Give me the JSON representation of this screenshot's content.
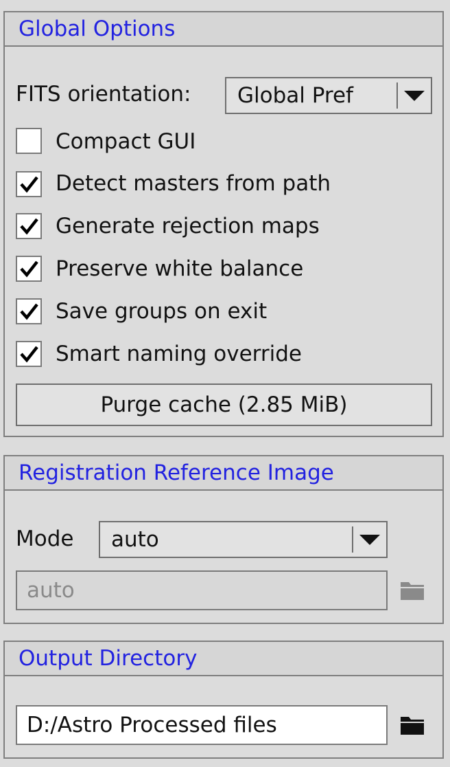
{
  "global_options": {
    "title": "Global Options",
    "fits_orientation": {
      "label": "FITS orientation:",
      "value": "Global Pref"
    },
    "checkboxes": [
      {
        "label": "Compact GUI",
        "checked": false
      },
      {
        "label": "Detect masters from path",
        "checked": true
      },
      {
        "label": "Generate rejection maps",
        "checked": true
      },
      {
        "label": "Preserve white balance",
        "checked": true
      },
      {
        "label": "Save groups on exit",
        "checked": true
      },
      {
        "label": "Smart naming override",
        "checked": true
      }
    ],
    "purge_button": "Purge cache (2.85 MiB)"
  },
  "registration": {
    "title": "Registration Reference Image",
    "mode_label": "Mode",
    "mode_value": "auto",
    "path_value": "auto"
  },
  "output": {
    "title": "Output Directory",
    "path_value": "D:/Astro Processed files"
  },
  "icons": {
    "dropdown": "chevron-down-icon",
    "checkmark": "checkmark-icon",
    "folder": "folder-icon"
  },
  "colors": {
    "section_title": "#2222e0",
    "panel_background": "#dcdcdc",
    "border": "#7e7e7e",
    "disabled_text": "#8a8a8a"
  }
}
